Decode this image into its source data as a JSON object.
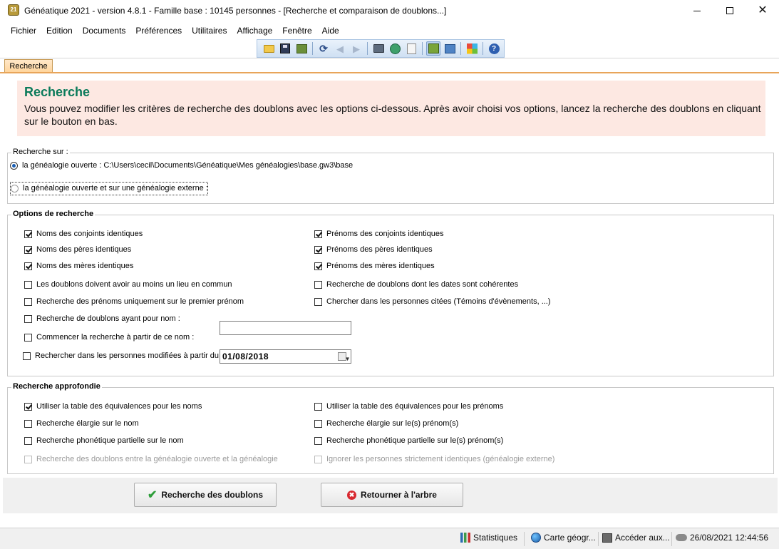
{
  "window": {
    "title": "Généatique 2021 - version 4.8.1 - Famille base : 10145 personnes - [Recherche et comparaison de doublons...]",
    "app_icon_text": "21"
  },
  "menu": [
    "Fichier",
    "Edition",
    "Documents",
    "Préférences",
    "Utilitaires",
    "Affichage",
    "Fenêtre",
    "Aide"
  ],
  "toolbar": {
    "icons": [
      "folder-icon",
      "save-icon",
      "book-icon",
      "refresh-icon",
      "back-arrow-icon",
      "forward-arrow-icon",
      "print-icon",
      "gear-icon",
      "document-icon",
      "edit-icon",
      "panel-icon",
      "grid-icon",
      "help-icon"
    ],
    "help_glyph": "?",
    "refresh_glyph": "⟳",
    "back_glyph": "◀",
    "forward_glyph": "▶"
  },
  "tab": {
    "label": "Recherche"
  },
  "banner": {
    "title": "Recherche",
    "text": "Vous pouvez modifier les critères de recherche des doublons avec les options ci-dessous.  Après  avoir choisi vos options, lancez la recherche des doublons en cliquant sur le bouton en bas."
  },
  "search_on": {
    "legend": "Recherche sur :",
    "option1": "la généalogie ouverte : C:\\Users\\cecil\\Documents\\Généatique\\Mes généalogies\\base.gw3\\base",
    "option2": "la généalogie ouverte et sur une généalogie externe :"
  },
  "options": {
    "legend": "Options de recherche",
    "left": [
      {
        "label": "Noms des conjoints identiques",
        "checked": true
      },
      {
        "label": "Noms des pères identiques",
        "checked": true
      },
      {
        "label": "Noms des mères identiques",
        "checked": true
      },
      {
        "label": "Les doublons doivent avoir au moins un lieu en commun",
        "checked": false
      },
      {
        "label": "Recherche des prénoms uniquement sur le premier prénom",
        "checked": false
      },
      {
        "label": "Recherche de doublons ayant pour nom :",
        "checked": false
      },
      {
        "label": "Commencer la recherche à partir de ce nom :",
        "checked": false
      }
    ],
    "right": [
      {
        "label": "Prénoms des conjoints identiques",
        "checked": true
      },
      {
        "label": "Prénoms des pères identiques",
        "checked": true
      },
      {
        "label": "Prénoms des mères identiques",
        "checked": true
      },
      {
        "label": "Recherche de doublons dont les dates sont cohérentes",
        "checked": false
      },
      {
        "label": "Chercher dans les personnes citées (Témoins d'évènements, ...)",
        "checked": false
      }
    ],
    "modified_label": "Rechercher dans les personnes modifiées à partir du :",
    "name_value": "",
    "date_value": "01/08/2018",
    "date_dropdown_glyph": "▼"
  },
  "deep": {
    "legend": "Recherche approfondie",
    "left": [
      {
        "label": "Utiliser la table des équivalences pour les noms",
        "checked": true
      },
      {
        "label": "Recherche élargie sur le nom",
        "checked": false
      },
      {
        "label": "Recherche phonétique partielle sur le nom",
        "checked": false
      },
      {
        "label": "Recherche des doublons entre la généalogie ouverte et la généalogie",
        "checked": false
      }
    ],
    "right": [
      {
        "label": "Utiliser la table des équivalences pour les prénoms",
        "checked": false
      },
      {
        "label": "Recherche élargie sur le(s) prénom(s)",
        "checked": false
      },
      {
        "label": "Recherche phonétique partielle sur le(s) prénom(s)",
        "checked": false
      },
      {
        "label": "Ignorer les personnes strictement identiques (généalogie externe)",
        "checked": false
      }
    ]
  },
  "buttons": {
    "search": "Recherche des doublons",
    "return": "Retourner à l'arbre",
    "check_glyph": "✔",
    "stop_glyph": "✖"
  },
  "status": {
    "stats": "Statistiques",
    "map": "Carte géogr...",
    "access": "Accéder aux...",
    "datetime": "26/08/2021 12:44:56"
  },
  "colors": {
    "banner_bg": "#fde8e2",
    "banner_title": "#0a7a5a",
    "tab_accent": "#e8a55a"
  }
}
